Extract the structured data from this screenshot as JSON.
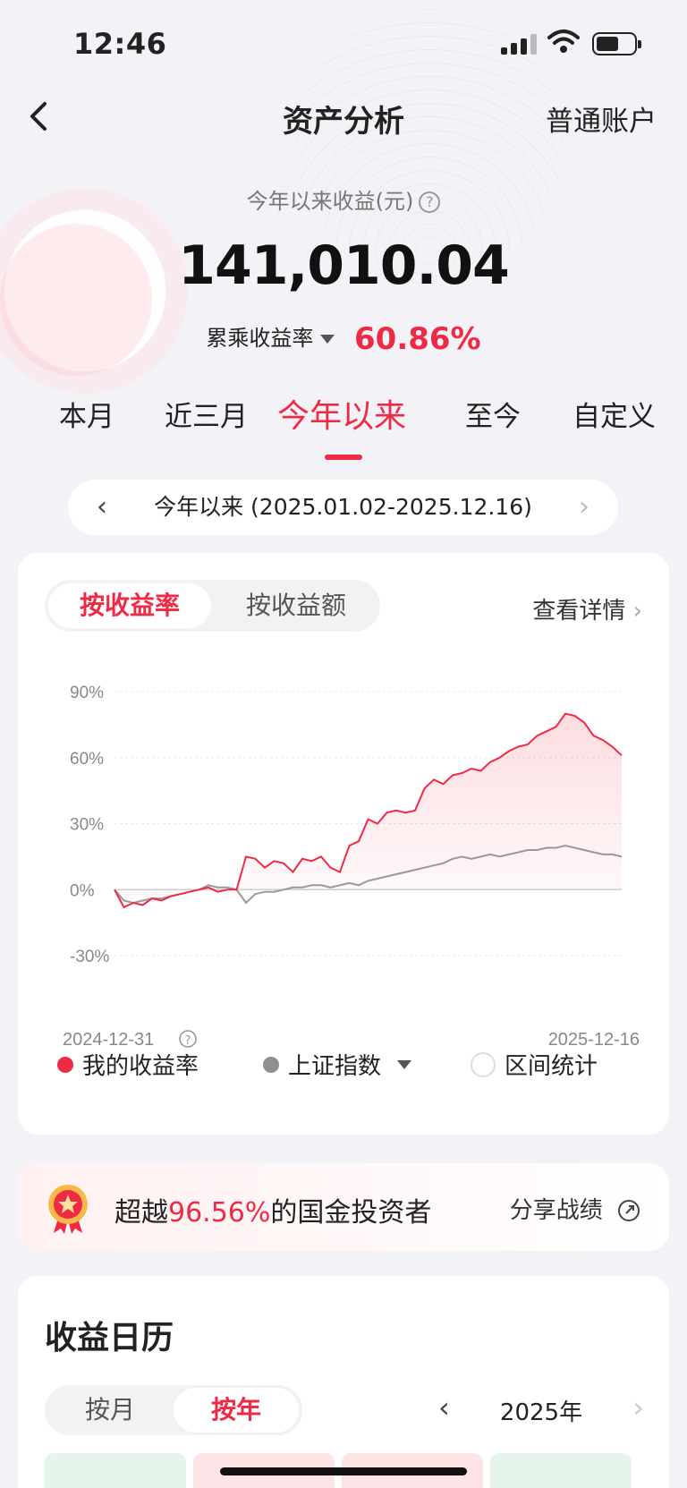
{
  "status": {
    "time": "12:46"
  },
  "nav": {
    "title": "资产分析",
    "account": "普通账户"
  },
  "summary": {
    "label": "今年以来收益(元)",
    "amount": "141,010.04",
    "rate_label": "累乘收益率",
    "rate_value": "60.86%"
  },
  "tabs": [
    "本月",
    "近三月",
    "今年以来",
    "至今",
    "自定义"
  ],
  "active_tab": "今年以来",
  "range": {
    "label": "今年以来 (2025.01.02-2025.12.16)"
  },
  "chart_card": {
    "seg_on": "按收益率",
    "seg_off": "按收益额",
    "detail": "查看详情",
    "legend": [
      "我的收益率",
      "上证指数",
      "区间统计"
    ]
  },
  "chart_data": {
    "type": "line",
    "x_start": "2024-12-31",
    "x_end": "2025-12-16",
    "yticks": [
      "90%",
      "60%",
      "30%",
      "0%",
      "-30%"
    ],
    "ylim": [
      -30,
      90
    ],
    "series": [
      {
        "name": "我的收益率",
        "color": "#ef2a45",
        "values": [
          0,
          -8,
          -6,
          -7,
          -4,
          -5,
          -3,
          -2,
          -1,
          0,
          1,
          -1,
          0,
          0,
          15,
          14,
          10,
          13,
          12,
          8,
          14,
          13,
          15,
          10,
          8,
          20,
          22,
          32,
          30,
          35,
          36,
          35,
          36,
          46,
          50,
          48,
          52,
          53,
          55,
          54,
          58,
          60,
          63,
          65,
          66,
          70,
          72,
          74,
          80,
          79,
          76,
          70,
          68,
          65,
          61
        ]
      },
      {
        "name": "上证指数",
        "color": "#999999",
        "values": [
          0,
          -5,
          -6,
          -5,
          -4,
          -4,
          -3,
          -2,
          -1,
          0,
          2,
          1,
          1,
          0,
          -6,
          -2,
          -1,
          -1,
          0,
          1,
          1,
          2,
          2,
          1,
          2,
          3,
          2,
          4,
          5,
          6,
          7,
          8,
          9,
          10,
          11,
          12,
          14,
          15,
          14,
          15,
          16,
          15,
          16,
          17,
          18,
          18,
          19,
          19,
          20,
          19,
          18,
          17,
          16,
          16,
          15
        ]
      }
    ]
  },
  "beat": {
    "pre": "超越",
    "pct": "96.56%",
    "post": "的国金投资者",
    "share": "分享战绩"
  },
  "calendar": {
    "title": "收益日历",
    "seg_off": "按月",
    "seg_on": "按年",
    "year": "2025年"
  },
  "colors": {
    "accent": "#ef2a45",
    "index": "#999999"
  }
}
